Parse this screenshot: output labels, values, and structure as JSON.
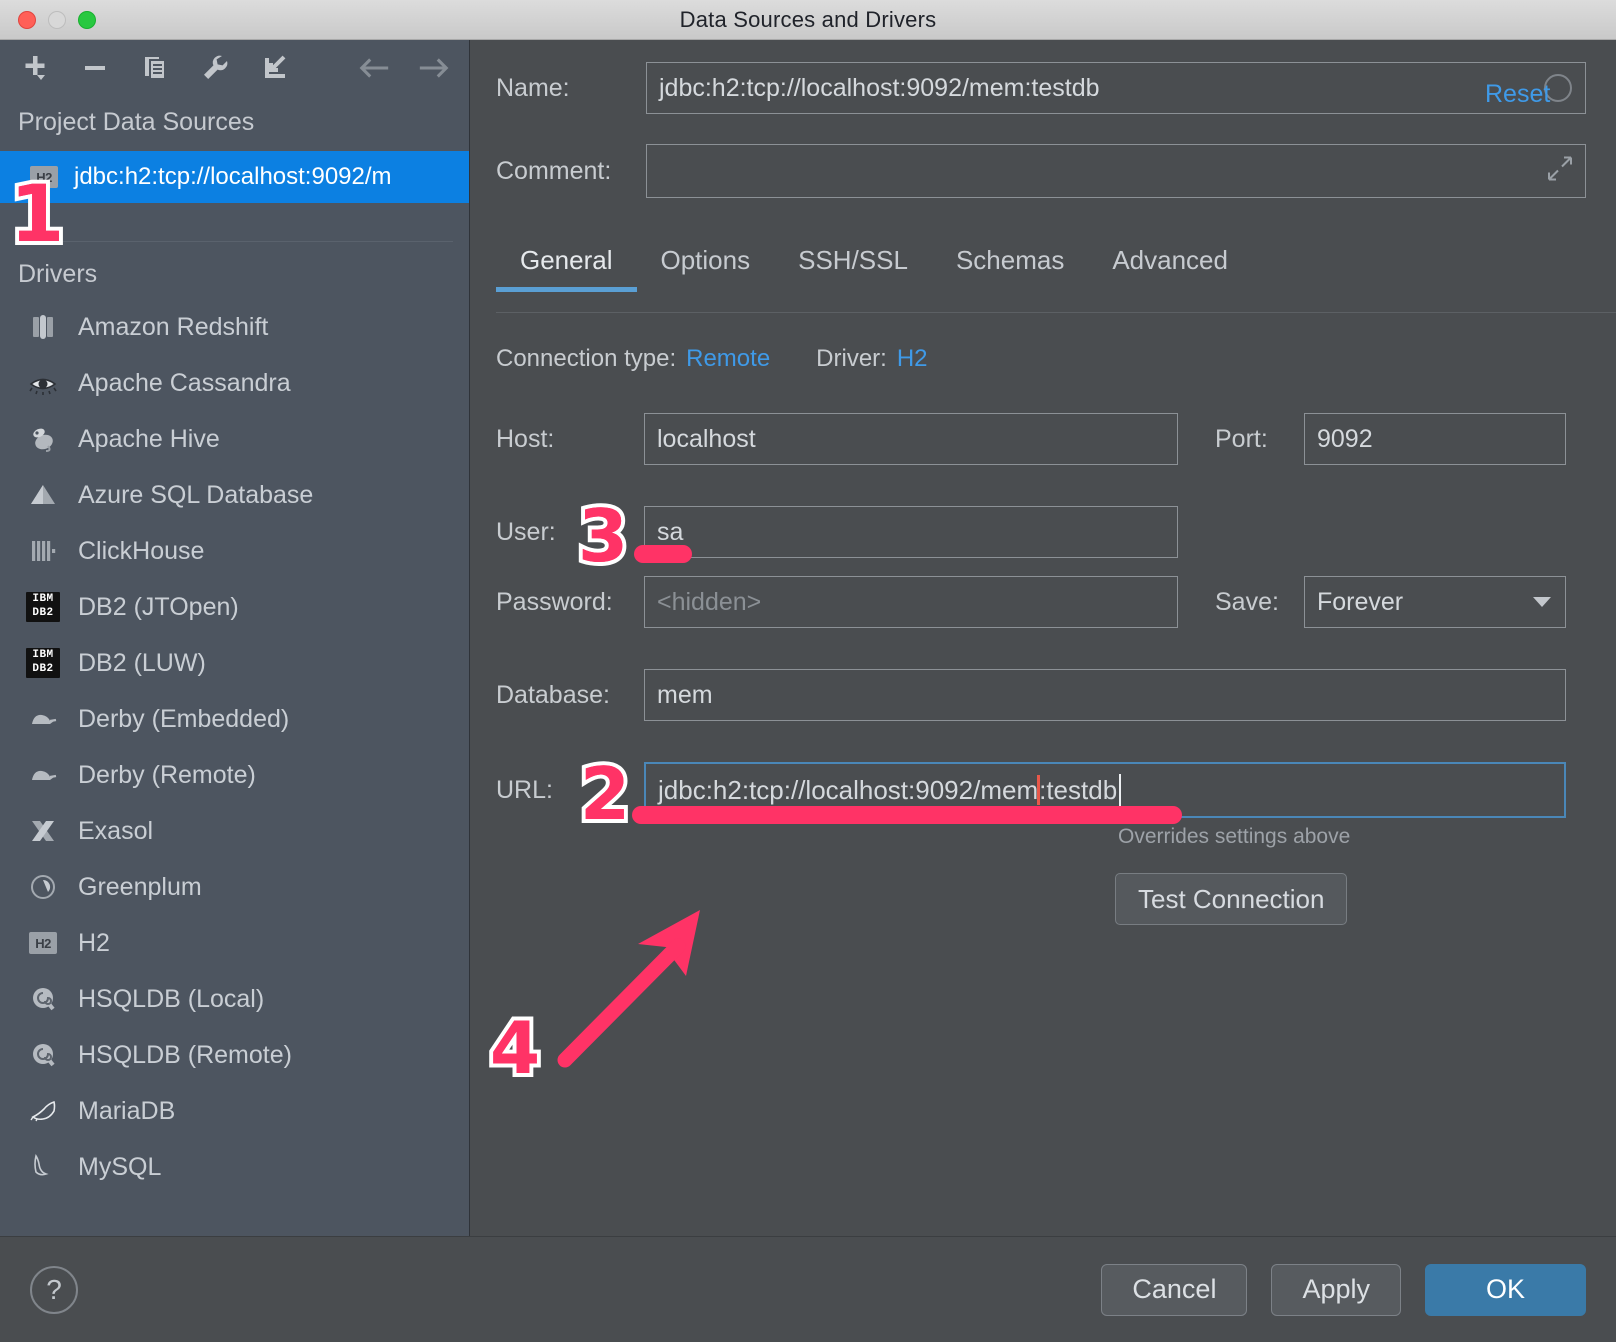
{
  "window": {
    "title": "Data Sources and Drivers",
    "traffic_lights": [
      "close-button",
      "minimize-button",
      "zoom-button"
    ]
  },
  "sidebar": {
    "toolbar": [
      {
        "name": "add-button",
        "icon": "plus-icon"
      },
      {
        "name": "remove-button",
        "icon": "minus-icon"
      },
      {
        "name": "duplicate-button",
        "icon": "copy-icon"
      },
      {
        "name": "properties-button",
        "icon": "wrench-icon"
      },
      {
        "name": "import-button",
        "icon": "import-arrow-icon"
      },
      {
        "name": "back-button",
        "icon": "arrow-left-icon"
      },
      {
        "name": "forward-button",
        "icon": "arrow-right-icon"
      }
    ],
    "project_section_title": "Project Data Sources",
    "selected_data_source": {
      "label": "jdbc:h2:tcp://localhost:9092/m",
      "icon": "h2-icon",
      "icon_text": "H2",
      "selected": true
    },
    "drivers_section_title": "Drivers",
    "drivers": [
      {
        "label": "Amazon Redshift",
        "icon": "redshift-icon"
      },
      {
        "label": "Apache Cassandra",
        "icon": "cassandra-eye-icon"
      },
      {
        "label": "Apache Hive",
        "icon": "hive-bee-icon"
      },
      {
        "label": "Azure SQL Database",
        "icon": "azure-icon"
      },
      {
        "label": "ClickHouse",
        "icon": "clickhouse-icon"
      },
      {
        "label": "DB2 (JTOpen)",
        "icon": "ibm-db2-icon",
        "icon_text": "IBM DB2"
      },
      {
        "label": "DB2 (LUW)",
        "icon": "ibm-db2-icon",
        "icon_text": "IBM DB2"
      },
      {
        "label": "Derby (Embedded)",
        "icon": "derby-hat-icon"
      },
      {
        "label": "Derby (Remote)",
        "icon": "derby-hat-icon"
      },
      {
        "label": "Exasol",
        "icon": "exasol-x-icon"
      },
      {
        "label": "Greenplum",
        "icon": "greenplum-icon"
      },
      {
        "label": "H2",
        "icon": "h2-icon",
        "icon_text": "H2"
      },
      {
        "label": "HSQLDB (Local)",
        "icon": "hsqldb-icon"
      },
      {
        "label": "HSQLDB (Remote)",
        "icon": "hsqldb-icon"
      },
      {
        "label": "MariaDB",
        "icon": "mariadb-seal-icon"
      },
      {
        "label": "MySQL",
        "icon": "mysql-dolphin-icon"
      }
    ]
  },
  "main": {
    "name_label": "Name:",
    "name_value": "jdbc:h2:tcp://localhost:9092/mem:testdb",
    "comment_label": "Comment:",
    "comment_value": "",
    "reset_label": "Reset",
    "tabs": [
      {
        "label": "General",
        "active": true
      },
      {
        "label": "Options",
        "active": false
      },
      {
        "label": "SSH/SSL",
        "active": false
      },
      {
        "label": "Schemas",
        "active": false
      },
      {
        "label": "Advanced",
        "active": false
      }
    ],
    "connection_type_label": "Connection type:",
    "connection_type_value": "Remote",
    "driver_label": "Driver:",
    "driver_value": "H2",
    "host_label": "Host:",
    "host_value": "localhost",
    "port_label": "Port:",
    "port_value": "9092",
    "user_label": "User:",
    "user_value": "sa",
    "password_label": "Password:",
    "password_placeholder": "<hidden>",
    "save_label": "Save:",
    "save_value": "Forever",
    "database_label": "Database:",
    "database_value": "mem",
    "url_label": "URL:",
    "url_value_before_marker": "jdbc:h2:tcp://localhost:9092/mem",
    "url_value_after_marker": ":testdb",
    "url_hint": "Overrides settings above",
    "test_connection_label": "Test Connection"
  },
  "footer": {
    "help_label": "?",
    "cancel_label": "Cancel",
    "apply_label": "Apply",
    "ok_label": "OK"
  },
  "annotations": [
    {
      "number": "1",
      "target": "selected-data-source"
    },
    {
      "number": "2",
      "target": "url-field"
    },
    {
      "number": "3",
      "target": "user-field"
    },
    {
      "number": "4",
      "target": "test-connection-button"
    }
  ],
  "colors": {
    "accent_blue": "#0c80e2",
    "link_blue": "#3f9ae8",
    "annotation_pink": "#ff3366",
    "primary_button": "#3a7aa8",
    "sidebar_bg": "#4d5560",
    "panel_bg": "#4a4d50"
  }
}
